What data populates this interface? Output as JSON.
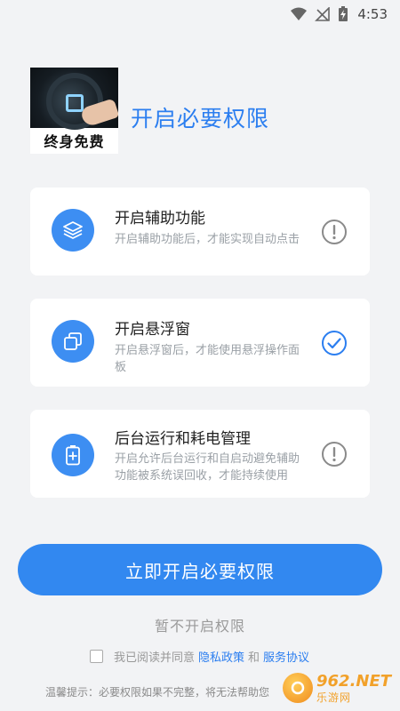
{
  "status_bar": {
    "time": "4:53"
  },
  "logo": {
    "caption": "终身免费"
  },
  "page_title": "开启必要权限",
  "permissions": [
    {
      "title": "开启辅助功能",
      "description": "开启辅助功能后，才能实现自动点击",
      "icon": "layers-icon",
      "status": "warning",
      "status_icon": "exclamation-circle-icon"
    },
    {
      "title": "开启悬浮窗",
      "description": "开启悬浮窗后，才能使用悬浮操作面板",
      "icon": "floating-window-icon",
      "status": "granted",
      "status_icon": "check-circle-icon"
    },
    {
      "title": "后台运行和耗电管理",
      "description": "开启允许后台运行和自启动避免辅助功能被系统误回收，才能持续使用",
      "icon": "battery-plus-icon",
      "status": "warning",
      "status_icon": "exclamation-circle-icon"
    }
  ],
  "primary_button": "立即开启必要权限",
  "skip_link": "暂不开启权限",
  "agreement": {
    "prefix": "我已阅读并同意",
    "privacy_link": "隐私政策",
    "conjunction": "和",
    "service_link": "服务协议",
    "checked": false
  },
  "tip": "温馨提示：必要权限如果不完整，将无法帮助您",
  "watermark": {
    "domain": "962.NET",
    "sub": "乐游网"
  },
  "colors": {
    "accent": "#3288f0",
    "title": "#2b7ef0",
    "background": "#f2f3f5",
    "muted_text": "#9aa0a6",
    "warning_icon": "#8a8a8a",
    "check_icon": "#2b7ef0"
  }
}
